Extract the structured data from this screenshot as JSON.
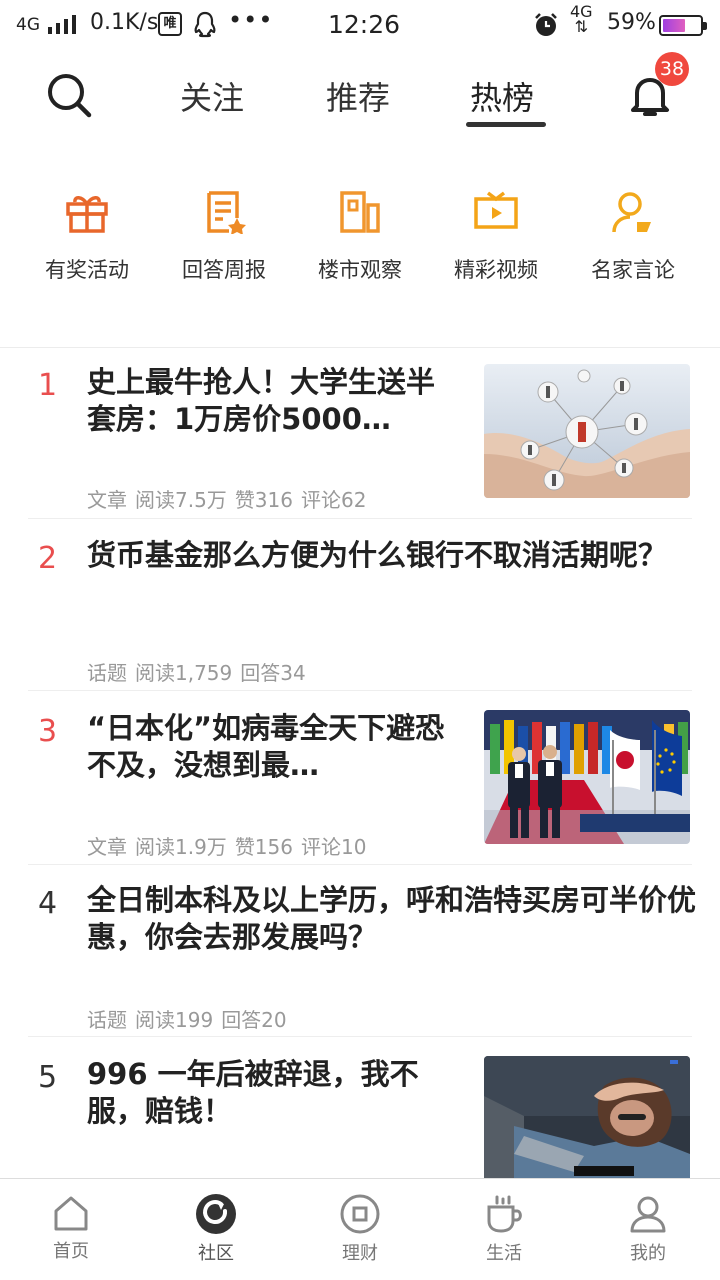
{
  "status_bar": {
    "network": "4G",
    "speed": "0.1K/s",
    "app_badge": "唯",
    "dots": "•••",
    "time": "12:26",
    "data_type": "4G",
    "battery_pct": "59%",
    "battery_level": 0.59
  },
  "top_nav": {
    "tabs": [
      "关注",
      "推荐",
      "热榜"
    ],
    "active_tab": "热榜",
    "notification_count": "38"
  },
  "quick_entries": [
    {
      "label": "有奖活动",
      "icon": "gift-icon",
      "color": "#e8672b"
    },
    {
      "label": "回答周报",
      "icon": "report-icon",
      "color": "#ee8a25"
    },
    {
      "label": "楼市观察",
      "icon": "building-icon",
      "color": "#f0962e"
    },
    {
      "label": "精彩视频",
      "icon": "video-icon",
      "color": "#f4a417"
    },
    {
      "label": "名家言论",
      "icon": "user-comment-icon",
      "color": "#f2a91c"
    }
  ],
  "hot_list": [
    {
      "rank": "1",
      "title": "史上最牛抢人！大学生送半套房：1万房价5000…",
      "meta": [
        "文章",
        "阅读7.5万",
        "赞316",
        "评论62"
      ]
    },
    {
      "rank": "2",
      "title": "货币基金那么方便为什么银行不取消活期呢？",
      "meta": [
        "话题",
        "阅读1,759",
        "回答34"
      ]
    },
    {
      "rank": "3",
      "title": "“日本化”如病毒全天下避恐不及，没想到最…",
      "meta": [
        "文章",
        "阅读1.9万",
        "赞156",
        "评论10"
      ]
    },
    {
      "rank": "4",
      "title": "全日制本科及以上学历，呼和浩特买房可半价优惠，你会去那发展吗？",
      "meta": [
        "话题",
        "阅读199",
        "回答20"
      ]
    },
    {
      "rank": "5",
      "title": "996 一年后被辞退，我不服，赔钱！",
      "meta": []
    }
  ],
  "bottom_nav": [
    {
      "label": "首页",
      "icon": "home-icon"
    },
    {
      "label": "社区",
      "icon": "community-icon"
    },
    {
      "label": "理财",
      "icon": "finance-icon"
    },
    {
      "label": "生活",
      "icon": "cup-icon"
    },
    {
      "label": "我的",
      "icon": "profile-icon"
    }
  ],
  "colors": {
    "hot_rank": "#e94e4e",
    "badge": "#f0483e",
    "meta_text": "#999999"
  }
}
